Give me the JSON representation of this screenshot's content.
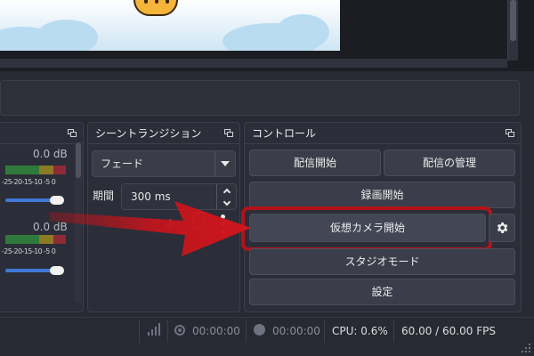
{
  "mixer": {
    "track1_db": "0.0 dB",
    "track2_db": "0.0 dB",
    "tick_labels": "-25-20-15-10 -5 0"
  },
  "transitions": {
    "title": "シーントランジション",
    "selected": "フェード",
    "duration_label": "期間",
    "duration_value": "300 ms"
  },
  "controls": {
    "title": "コントロール",
    "start_streaming": "配信開始",
    "manage_broadcast": "配信の管理",
    "start_recording": "録画開始",
    "start_virtual_camera": "仮想カメラ開始",
    "studio_mode": "スタジオモード",
    "settings": "設定"
  },
  "statusbar": {
    "stream_time": "00:00:00",
    "record_time": "00:00:00",
    "cpu": "CPU: 0.6%",
    "fps": "60.00 / 60.00 FPS"
  },
  "colors": {
    "highlight": "#b3121a",
    "accent_blue": "#3f78d6"
  },
  "icons": {
    "float": "float-icon",
    "gear": "gear-icon",
    "menu": "vertical-dots-icon",
    "add": "plus-icon",
    "remove": "trash-icon",
    "network": "signal-bars-icon",
    "stream": "broadcast-icon",
    "record": "record-dot-icon"
  }
}
